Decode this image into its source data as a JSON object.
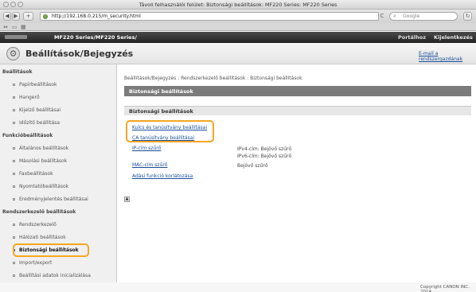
{
  "window": {
    "title": "Távoli felhasználói felület: Biztonsági beállítások: MF220 Series: MF220 Series"
  },
  "toolbar": {
    "back": "◀",
    "forward": "▶",
    "add": "+",
    "url": "http://192.168.0.215/m_security.html",
    "reload": "C",
    "search_placeholder": "Google"
  },
  "prodbar": {
    "model": "MF220 Series/MF220 Series/",
    "portal": "Portálhoz",
    "logout": "Kijelentkezés"
  },
  "page": {
    "title": "Beállítások/Bejegyzés",
    "email_link": "E-mail a rendszergazdának"
  },
  "sidebar": {
    "sections": [
      {
        "label": "Beállítások"
      },
      {
        "label": "Funkcióbeállítások"
      },
      {
        "label": "Rendszerkezelő beállítások"
      }
    ],
    "items": [
      {
        "label": "Papírbeállítások"
      },
      {
        "label": "Hangerő"
      },
      {
        "label": "Kijelző beállításai"
      },
      {
        "label": "Időzítő beállítása"
      },
      {
        "label": "Általános beállítások"
      },
      {
        "label": "Másolási beállítások"
      },
      {
        "label": "Faxbeállítások"
      },
      {
        "label": "Nyomtatóbeállítások"
      },
      {
        "label": "Eredményjelentés beállításai"
      },
      {
        "label": "Rendszerkezelő"
      },
      {
        "label": "Hálózati beállítások"
      },
      {
        "label": "Biztonsági beállítások"
      },
      {
        "label": "Import/export"
      },
      {
        "label": "Beállítási adatok inicializálása"
      }
    ]
  },
  "main": {
    "breadcrumb": "Beállítások/Bejegyzés : Rendszerkezelő beállítások : Biztonsági beállítások",
    "bar_title": "Biztonsági beállítások",
    "section_title": "Biztonsági beállítások",
    "links": [
      {
        "label": "Kulcs és tanúsítvány beállításai"
      },
      {
        "label": "CA tanúsítvány beállításai"
      },
      {
        "label": "IP-cím szűrő"
      },
      {
        "label": "MAC-cím szűrő"
      },
      {
        "label": "Adási funkció korlátozása"
      }
    ],
    "values": {
      "ipv4": "IPv4-cím: Bejövő szűrő",
      "ipv6": "IPv6-cím: Bejövő szűrő",
      "mac": "Bejövő szűrő"
    }
  },
  "footer": {
    "copyright": "Copyright CANON INC. 2014"
  },
  "colors": {
    "highlight": "#f6a623",
    "link": "#1a4e99",
    "header_dark": "#222222"
  }
}
